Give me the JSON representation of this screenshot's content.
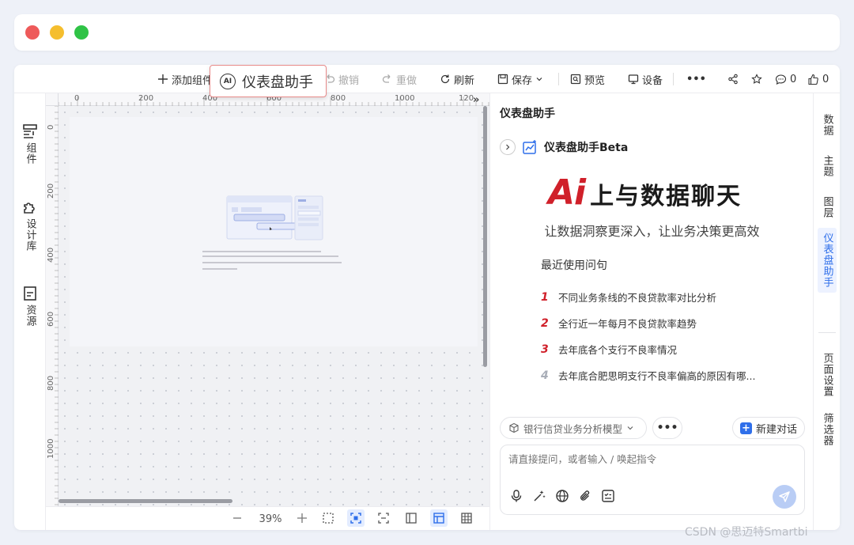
{
  "toolbar": {
    "add_component": "添加组件",
    "undo": "撤销",
    "redo": "重做",
    "refresh": "刷新",
    "save": "保存",
    "preview": "预览",
    "device": "设备",
    "more": "•••",
    "comments_count": "0",
    "likes_count": "0"
  },
  "assistant_popup": {
    "badge": "AI",
    "label": "仪表盘助手"
  },
  "left_sidebar": {
    "items": [
      {
        "label": "组件",
        "icon": "component-icon"
      },
      {
        "label": "设计库",
        "icon": "puzzle-icon"
      },
      {
        "label": "资源",
        "icon": "resource-icon"
      }
    ]
  },
  "canvas": {
    "ruler_top": [
      "0",
      "200",
      "400",
      "600",
      "800",
      "1000",
      "120"
    ],
    "ruler_left": [
      "0",
      "200",
      "400",
      "600",
      "800",
      "1000"
    ],
    "collapse": "»",
    "zoom": "39%"
  },
  "right_panel": {
    "title": "仪表盘助手",
    "header": "仪表盘助手Beta",
    "hero_ai": "Ai",
    "hero_text": "上与数据聊天",
    "subtitle": "让数据洞察更深入，让业务决策更高效",
    "recent_title": "最近使用问句",
    "recent": [
      {
        "num": "1",
        "text": "不同业务条线的不良贷款率对比分析",
        "color": "#d0202a"
      },
      {
        "num": "2",
        "text": "全行近一年每月不良贷款率趋势",
        "color": "#d0202a"
      },
      {
        "num": "3",
        "text": "去年底各个支行不良率情况",
        "color": "#d0202a"
      },
      {
        "num": "4",
        "text": "去年底合肥思明支行不良率偏高的原因有哪...",
        "color": "#a8adb7"
      }
    ],
    "model": "银行信贷业务分析模型",
    "more": "•••",
    "new_chat": "新建对话",
    "input_placeholder": "请直接提问，或者输入 / 唤起指令"
  },
  "right_tabs": [
    {
      "label": "数据",
      "active": false
    },
    {
      "label": "主题",
      "active": false
    },
    {
      "label": "图层",
      "active": false
    },
    {
      "label": "仪表盘助手",
      "active": true
    },
    {
      "label": "页面设置",
      "active": false
    },
    {
      "label": "筛选器",
      "active": false
    }
  ],
  "watermark": "CSDN @思迈特Smartbi",
  "colors": {
    "accent": "#2f6fea",
    "brand_red": "#d0202a"
  }
}
